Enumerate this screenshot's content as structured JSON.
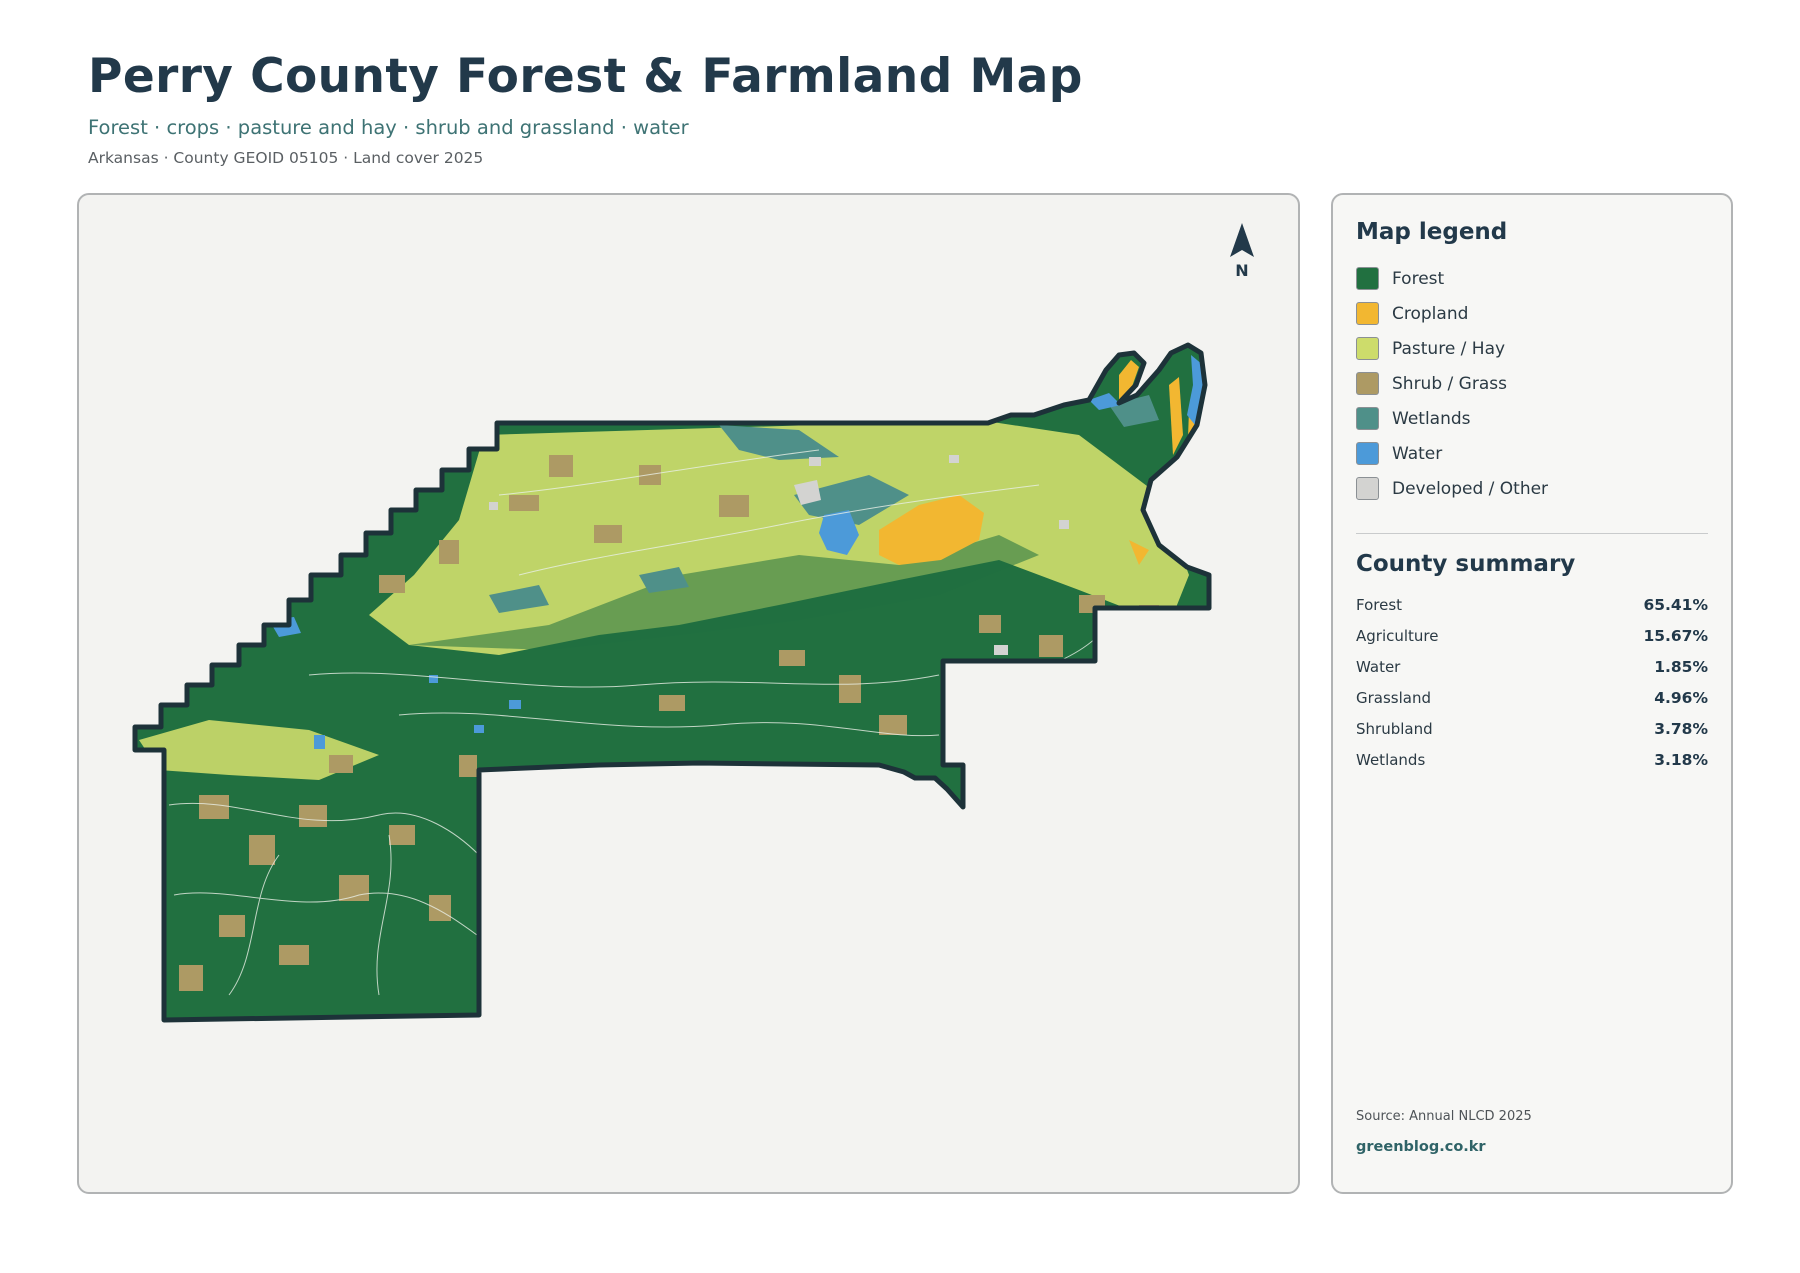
{
  "header": {
    "title": "Perry County Forest & Farmland Map",
    "subtitle": "Forest · crops · pasture and hay · shrub and grassland · water",
    "meta": "Arkansas · County GEOID 05105 · Land cover 2025"
  },
  "map": {
    "north_label": "N",
    "icons": [
      "north-arrow-icon"
    ]
  },
  "legend": {
    "heading": "Map legend",
    "items": [
      {
        "label": "Forest",
        "color": "#217040"
      },
      {
        "label": "Cropland",
        "color": "#f2b731"
      },
      {
        "label": "Pasture / Hay",
        "color": "#cddc6b"
      },
      {
        "label": "Shrub / Grass",
        "color": "#ad9a64"
      },
      {
        "label": "Wetlands",
        "color": "#4f9089"
      },
      {
        "label": "Water",
        "color": "#4c9ad9"
      },
      {
        "label": "Developed / Other",
        "color": "#d3d3d1"
      }
    ]
  },
  "summary": {
    "heading": "County summary",
    "rows": [
      {
        "name": "Forest",
        "value": "65.41%"
      },
      {
        "name": "Agriculture",
        "value": "15.67%"
      },
      {
        "name": "Water",
        "value": "1.85%"
      },
      {
        "name": "Grassland",
        "value": "4.96%"
      },
      {
        "name": "Shrubland",
        "value": "3.78%"
      },
      {
        "name": "Wetlands",
        "value": "3.18%"
      }
    ]
  },
  "footer": {
    "source": "Source: Annual NLCD 2025",
    "site": "greenblog.co.kr"
  }
}
